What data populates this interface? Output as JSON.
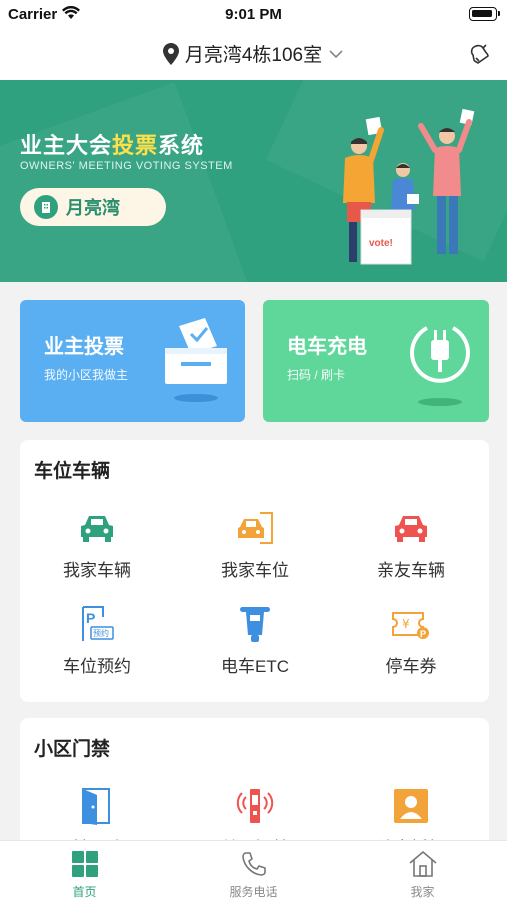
{
  "status_bar": {
    "carrier": "Carrier",
    "time": "9:01 PM"
  },
  "header": {
    "location": "月亮湾4栋106室"
  },
  "banner": {
    "title_prefix": "业主大会",
    "title_highlight": "投票",
    "title_suffix": "系统",
    "subtitle": "OWNERS' MEETING VOTING SYSTEM",
    "community": "月亮湾",
    "ballot_text": "vote!"
  },
  "quick_cards": {
    "vote": {
      "title": "业主投票",
      "subtitle": "我的小区我做主"
    },
    "charge": {
      "title": "电车充电",
      "subtitle": "扫码 / 刷卡"
    }
  },
  "parking_section": {
    "title": "车位车辆",
    "items": [
      {
        "label": "我家车辆",
        "icon": "car-icon",
        "color": "#2fa17e"
      },
      {
        "label": "我家车位",
        "icon": "garage-car-icon",
        "color": "#f2a33a"
      },
      {
        "label": "亲友车辆",
        "icon": "car-icon",
        "color": "#ef5350"
      },
      {
        "label": "车位预约",
        "icon": "parking-reservation-icon",
        "color": "#3d8fe0",
        "badge": "预约"
      },
      {
        "label": "电车ETC",
        "icon": "scooter-icon",
        "color": "#3d8fe0"
      },
      {
        "label": "停车券",
        "icon": "coupon-icon",
        "color": "#f2a33a"
      }
    ]
  },
  "access_section": {
    "title": "小区门禁",
    "items": [
      {
        "label": "手机开门",
        "icon": "door-icon",
        "color": "#3d8fe0"
      },
      {
        "label": "单元门禁",
        "icon": "access-control-icon",
        "color": "#ef5350"
      },
      {
        "label": "访客授权",
        "icon": "visitor-icon",
        "color": "#f2a33a"
      }
    ]
  },
  "tabbar": {
    "tabs": [
      {
        "label": "首页",
        "icon": "home-grid-icon",
        "active": true
      },
      {
        "label": "服务电话",
        "icon": "phone-icon",
        "active": false
      },
      {
        "label": "我家",
        "icon": "house-icon",
        "active": false
      }
    ]
  },
  "colors": {
    "primary": "#2fa17e",
    "highlight": "#ffe04a",
    "vote_card": "#5aaef2",
    "charge_card": "#5fd69a"
  }
}
